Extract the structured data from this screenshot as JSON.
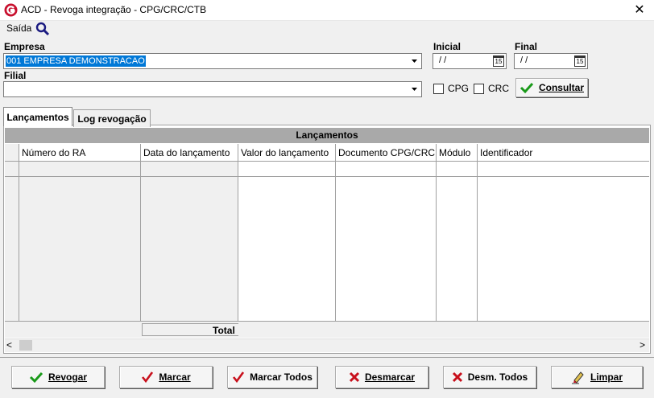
{
  "window": {
    "title": "ACD - Revoga integração - CPG/CRC/CTB",
    "close_glyph": "✕"
  },
  "menu": {
    "saida": "Saída",
    "search_icon": "search-icon"
  },
  "filters": {
    "empresa_label": "Empresa",
    "empresa_value": "001 EMPRESA DEMONSTRACAO",
    "filial_label": "Filial",
    "filial_value": "",
    "inicial_label": "Inicial",
    "inicial_value": "/ /",
    "final_label": "Final",
    "final_value": "/ /",
    "cal_glyph": "15",
    "cpg_label": "CPG",
    "crc_label": "CRC",
    "consultar_label": "Consultar"
  },
  "tabs": [
    {
      "label": "Lançamentos",
      "active": true
    },
    {
      "label": "Log revogação",
      "active": false
    }
  ],
  "grid": {
    "title": "Lançamentos",
    "columns": [
      "Número do RA",
      "Data do lançamento",
      "Valor do lançamento",
      "Documento CPG/CRC",
      "Módulo",
      "Identificador"
    ],
    "total_label": "Total"
  },
  "scrollbar": {
    "left_glyph": "<",
    "right_glyph": ">"
  },
  "buttons": {
    "revogar": "Revogar",
    "marcar": "Marcar",
    "marcar_todos": "Marcar Todos",
    "desmarcar": "Desmarcar",
    "desm_todos": "Desm. Todos",
    "limpar": "Limpar"
  },
  "colors": {
    "selection": "#0078d7",
    "check_green": "#1a9a1a",
    "cross_red": "#c8101c",
    "logo_red": "#c8102e"
  }
}
